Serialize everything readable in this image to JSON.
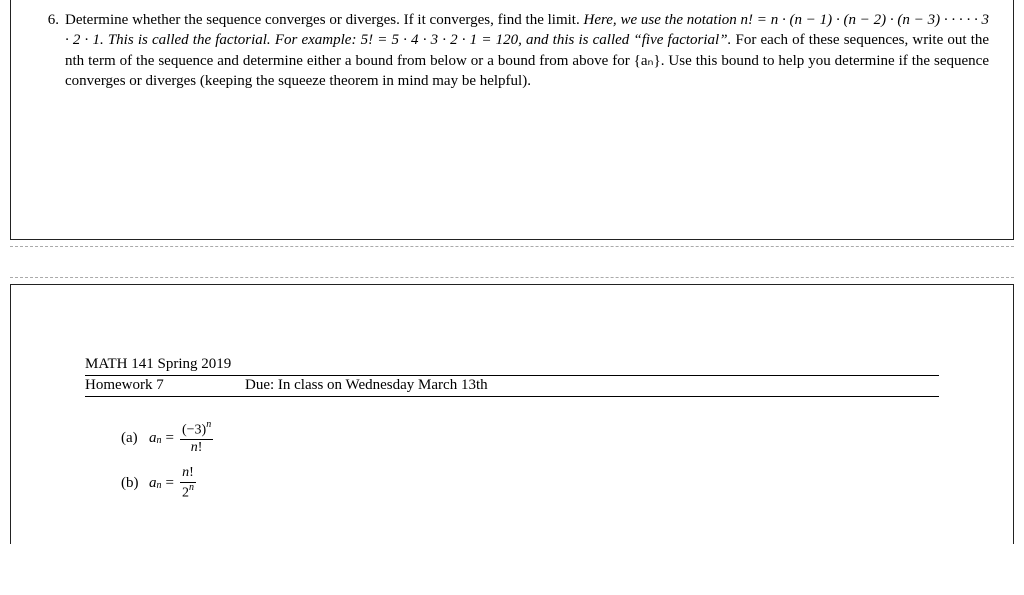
{
  "problem": {
    "number": "6.",
    "text_plain": "Determine whether the sequence converges or diverges. If it converges, find the limit.",
    "italic1": "Here, we use the notation n! = n · (n − 1) · (n − 2) · (n − 3) · · · · · 3 · 2 · 1.  This is called the factorial.  For example: 5! = 5 · 4 · 3 · 2 · 1 = 120, and this is called “five factorial”.",
    "text_rest": "For each of these sequences, write out the nth term of the sequence and determine either a bound from below or a bound from above for {aₙ}. Use this bound to help you determine if the sequence converges or diverges (keeping the squeeze theorem in mind may be helpful)."
  },
  "header": {
    "course": "MATH 141 Spring 2019",
    "hw": "Homework 7",
    "due": "Due:  In class on Wednesday March 13th"
  },
  "parts": {
    "a": {
      "label": "(a)",
      "lhs": "aₙ =",
      "num": "(−3)ⁿ",
      "den": "n!"
    },
    "b": {
      "label": "(b)",
      "lhs": "aₙ =",
      "num": "n!",
      "den": "2ⁿ"
    }
  }
}
